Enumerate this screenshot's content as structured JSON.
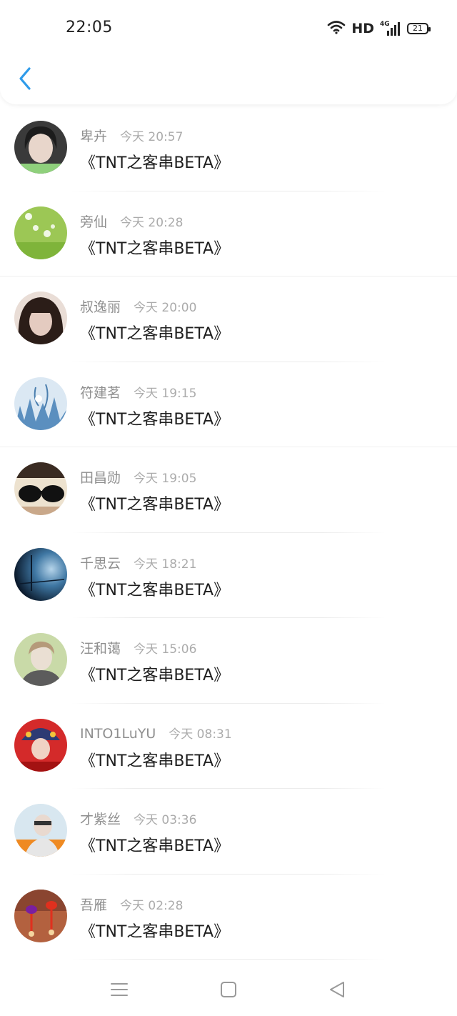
{
  "status": {
    "time": "22:05",
    "network_label": "HD",
    "signal_label": "4G",
    "battery": "21"
  },
  "messages": [
    {
      "name": "卑卉",
      "time": "今天 20:57",
      "content": "《TNT之客串BETA》",
      "avatar_colors": [
        "#3a3a3a",
        "#d9c8bd",
        "#8fd07c"
      ]
    },
    {
      "name": "旁仙",
      "time": "今天 20:28",
      "content": "《TNT之客串BETA》",
      "avatar_colors": [
        "#8fbf4a",
        "#c4dd86",
        "#ffffff"
      ]
    },
    {
      "name": "叔逸丽",
      "time": "今天 20:00",
      "content": "《TNT之客串BETA》",
      "avatar_colors": [
        "#2b1d18",
        "#e2c7bb",
        "#9a7a70"
      ]
    },
    {
      "name": "符建茗",
      "time": "今天 19:15",
      "content": "《TNT之客串BETA》",
      "avatar_colors": [
        "#4f86b8",
        "#d9e6f1",
        "#7aa6cf"
      ]
    },
    {
      "name": "田昌勋",
      "time": "今天 19:05",
      "content": "《TNT之客串BETA》",
      "avatar_colors": [
        "#e9dcc7",
        "#1a1a1a",
        "#c9a88a"
      ]
    },
    {
      "name": "千思云",
      "time": "今天 18:21",
      "content": "《TNT之客串BETA》",
      "avatar_colors": [
        "#0e1f33",
        "#6a9cc2",
        "#2d5f86"
      ]
    },
    {
      "name": "汪和蔼",
      "time": "今天 15:06",
      "content": "《TNT之客串BETA》",
      "avatar_colors": [
        "#c7d8a6",
        "#e8ddd2",
        "#5c5c5c"
      ]
    },
    {
      "name": "INTO1LuYU",
      "time": "今天 08:31",
      "content": "《TNT之客串BETA》",
      "avatar_colors": [
        "#c21a1a",
        "#2d3a73",
        "#f0d2c4"
      ]
    },
    {
      "name": "才紫丝",
      "time": "今天 03:36",
      "content": "《TNT之客串BETA》",
      "avatar_colors": [
        "#bcd8ea",
        "#ef8a22",
        "#e6e6e6"
      ]
    },
    {
      "name": "吾雁",
      "time": "今天 02:28",
      "content": "《TNT之客串BETA》",
      "avatar_colors": [
        "#a1543a",
        "#e0301e",
        "#f5d6a0"
      ]
    }
  ],
  "icons": {
    "back": "chevron-left-icon",
    "wifi": "wifi-icon",
    "signal": "signal-icon",
    "battery": "battery-icon",
    "menu": "menu-icon",
    "home": "square-icon",
    "back_nav": "triangle-back-icon"
  },
  "colors": {
    "accent": "#2f9bea",
    "name_text": "#8f8f8f",
    "time_text": "#ababab",
    "content_text": "#1f1f1f"
  }
}
